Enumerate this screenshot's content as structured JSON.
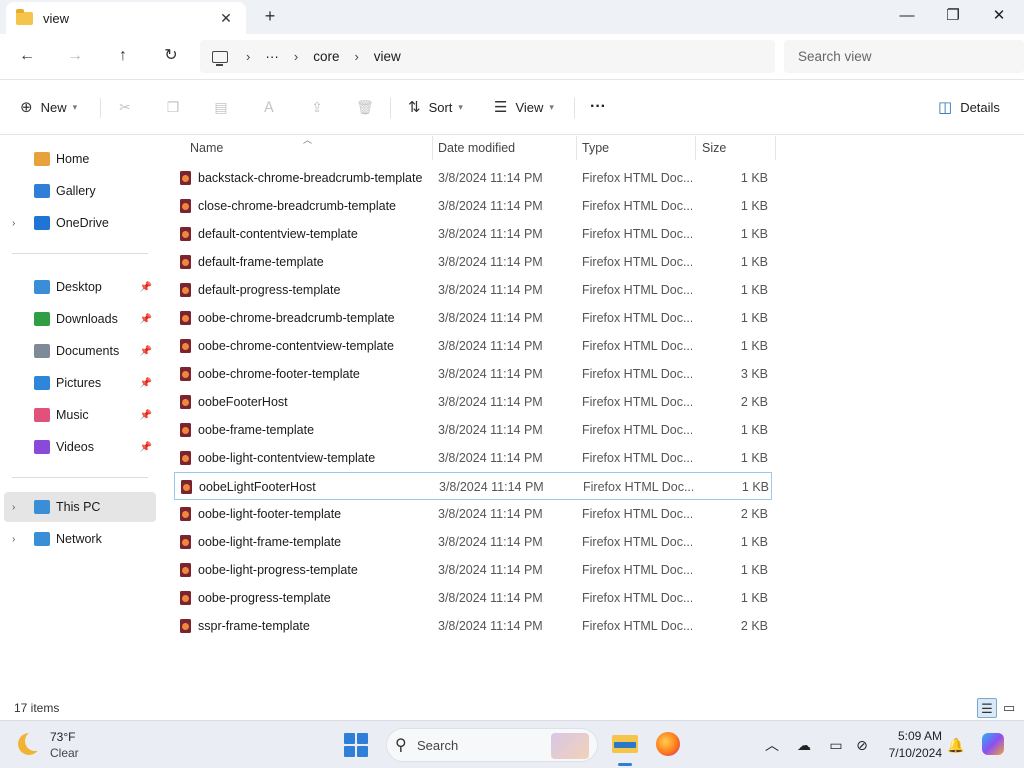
{
  "window": {
    "tab_title": "view",
    "tab_close": "✕",
    "new_tab": "+",
    "minimize": "—",
    "maximize": "❐",
    "close": "✕"
  },
  "nav": {
    "back": "←",
    "forward": "→",
    "up": "↑",
    "refresh": "↻",
    "breadcrumb_more": "···",
    "breadcrumb": [
      "core",
      "view"
    ],
    "separator": "›",
    "search_placeholder": "Search view"
  },
  "commands": {
    "new_label": "New",
    "sort_label": "Sort",
    "view_label": "View",
    "more": "···",
    "details_label": "Details"
  },
  "sidebar": {
    "groups": [
      [
        {
          "label": "Home",
          "icon": "home-icon",
          "color": "#e8a23b",
          "expandable": false
        },
        {
          "label": "Gallery",
          "icon": "gallery-icon",
          "color": "#2f7fd8",
          "expandable": false
        },
        {
          "label": "OneDrive",
          "icon": "onedrive-icon",
          "color": "#1f74d6",
          "expandable": true
        }
      ],
      [
        {
          "label": "Desktop",
          "icon": "desktop-icon",
          "color": "#3a8ed8",
          "pinned": true
        },
        {
          "label": "Downloads",
          "icon": "downloads-icon",
          "color": "#2ea043",
          "pinned": true
        },
        {
          "label": "Documents",
          "icon": "documents-icon",
          "color": "#7f8a99",
          "pinned": true
        },
        {
          "label": "Pictures",
          "icon": "pictures-icon",
          "color": "#2d86d9",
          "pinned": true
        },
        {
          "label": "Music",
          "icon": "music-icon",
          "color": "#e0527a",
          "pinned": true
        },
        {
          "label": "Videos",
          "icon": "videos-icon",
          "color": "#8a49d8",
          "pinned": true
        }
      ],
      [
        {
          "label": "This PC",
          "icon": "this-pc-icon",
          "color": "#3a8ed8",
          "expandable": true,
          "selected": true
        },
        {
          "label": "Network",
          "icon": "network-icon",
          "color": "#3a8ed8",
          "expandable": true
        }
      ]
    ]
  },
  "columns": {
    "name": "Name",
    "date": "Date modified",
    "type": "Type",
    "size": "Size"
  },
  "files": [
    {
      "name": "backstack-chrome-breadcrumb-template",
      "date": "3/8/2024 11:14 PM",
      "type": "Firefox HTML Doc...",
      "size": "1 KB"
    },
    {
      "name": "close-chrome-breadcrumb-template",
      "date": "3/8/2024 11:14 PM",
      "type": "Firefox HTML Doc...",
      "size": "1 KB"
    },
    {
      "name": "default-contentview-template",
      "date": "3/8/2024 11:14 PM",
      "type": "Firefox HTML Doc...",
      "size": "1 KB"
    },
    {
      "name": "default-frame-template",
      "date": "3/8/2024 11:14 PM",
      "type": "Firefox HTML Doc...",
      "size": "1 KB"
    },
    {
      "name": "default-progress-template",
      "date": "3/8/2024 11:14 PM",
      "type": "Firefox HTML Doc...",
      "size": "1 KB"
    },
    {
      "name": "oobe-chrome-breadcrumb-template",
      "date": "3/8/2024 11:14 PM",
      "type": "Firefox HTML Doc...",
      "size": "1 KB"
    },
    {
      "name": "oobe-chrome-contentview-template",
      "date": "3/8/2024 11:14 PM",
      "type": "Firefox HTML Doc...",
      "size": "1 KB"
    },
    {
      "name": "oobe-chrome-footer-template",
      "date": "3/8/2024 11:14 PM",
      "type": "Firefox HTML Doc...",
      "size": "3 KB"
    },
    {
      "name": "oobeFooterHost",
      "date": "3/8/2024 11:14 PM",
      "type": "Firefox HTML Doc...",
      "size": "2 KB"
    },
    {
      "name": "oobe-frame-template",
      "date": "3/8/2024 11:14 PM",
      "type": "Firefox HTML Doc...",
      "size": "1 KB"
    },
    {
      "name": "oobe-light-contentview-template",
      "date": "3/8/2024 11:14 PM",
      "type": "Firefox HTML Doc...",
      "size": "1 KB"
    },
    {
      "name": "oobeLightFooterHost",
      "date": "3/8/2024 11:14 PM",
      "type": "Firefox HTML Doc...",
      "size": "1 KB",
      "focused": true
    },
    {
      "name": "oobe-light-footer-template",
      "date": "3/8/2024 11:14 PM",
      "type": "Firefox HTML Doc...",
      "size": "2 KB"
    },
    {
      "name": "oobe-light-frame-template",
      "date": "3/8/2024 11:14 PM",
      "type": "Firefox HTML Doc...",
      "size": "1 KB"
    },
    {
      "name": "oobe-light-progress-template",
      "date": "3/8/2024 11:14 PM",
      "type": "Firefox HTML Doc...",
      "size": "1 KB"
    },
    {
      "name": "oobe-progress-template",
      "date": "3/8/2024 11:14 PM",
      "type": "Firefox HTML Doc...",
      "size": "1 KB"
    },
    {
      "name": "sspr-frame-template",
      "date": "3/8/2024 11:14 PM",
      "type": "Firefox HTML Doc...",
      "size": "2 KB"
    }
  ],
  "status": {
    "item_count": "17 items"
  },
  "taskbar": {
    "temperature": "73°F",
    "condition": "Clear",
    "search_label": "Search",
    "time": "5:09 AM",
    "date": "7/10/2024"
  }
}
